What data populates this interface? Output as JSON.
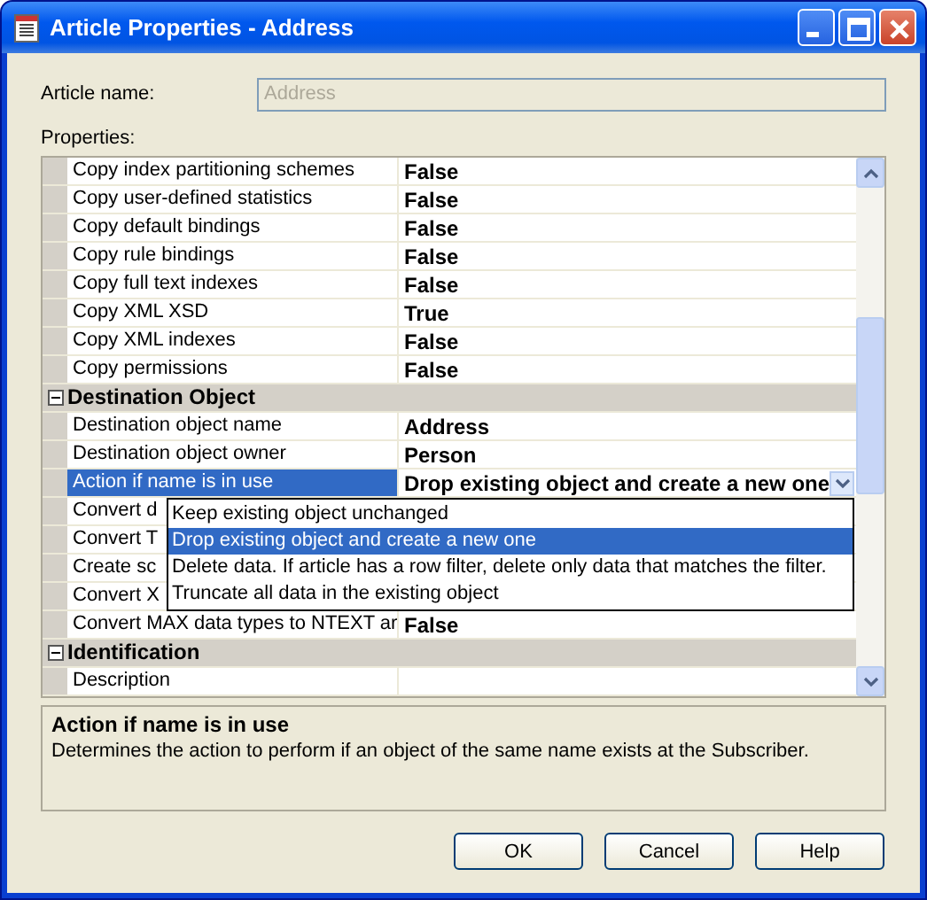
{
  "window": {
    "title": "Article Properties - Address"
  },
  "article_name": {
    "label": "Article name:",
    "value": "Address",
    "disabled": true
  },
  "properties_label": "Properties:",
  "grid": {
    "rows": [
      {
        "kind": "property",
        "name": "Copy index partitioning schemes",
        "value": "False",
        "selected": false
      },
      {
        "kind": "property",
        "name": "Copy user-defined statistics",
        "value": "False",
        "selected": false
      },
      {
        "kind": "property",
        "name": "Copy default bindings",
        "value": "False",
        "selected": false
      },
      {
        "kind": "property",
        "name": "Copy rule bindings",
        "value": "False",
        "selected": false
      },
      {
        "kind": "property",
        "name": "Copy full text indexes",
        "value": "False",
        "selected": false
      },
      {
        "kind": "property",
        "name": "Copy XML XSD",
        "value": "True",
        "selected": false
      },
      {
        "kind": "property",
        "name": "Copy XML indexes",
        "value": "False",
        "selected": false
      },
      {
        "kind": "property",
        "name": "Copy permissions",
        "value": "False",
        "selected": false
      },
      {
        "kind": "category",
        "name": "Destination Object",
        "expanded": true
      },
      {
        "kind": "property",
        "name": "Destination object name",
        "value": "Address",
        "selected": false
      },
      {
        "kind": "property",
        "name": "Destination object owner",
        "value": "Person",
        "selected": false
      },
      {
        "kind": "property",
        "name": "Action if name is in use",
        "value": "Drop existing object and create a new one",
        "selected": true,
        "dropdown_open": true
      },
      {
        "kind": "property",
        "name": "Convert d",
        "selected": false
      },
      {
        "kind": "property",
        "name": "Convert T",
        "selected": false
      },
      {
        "kind": "property",
        "name": "Create sc",
        "selected": false
      },
      {
        "kind": "property",
        "name": "Convert X",
        "selected": false
      },
      {
        "kind": "property",
        "name": "Convert MAX data types to NTEXT ar",
        "value": "False",
        "selected": false
      },
      {
        "kind": "category",
        "name": "Identification",
        "expanded": true
      },
      {
        "kind": "property",
        "name": "Description",
        "selected": false
      }
    ],
    "dropdown": {
      "options": [
        {
          "label": "Keep existing object unchanged",
          "selected": false
        },
        {
          "label": "Drop existing object and create a new one",
          "selected": true
        },
        {
          "label": "Delete data. If article has a row filter, delete only data that matches the filter.",
          "selected": false
        },
        {
          "label": "Truncate all data in the existing object",
          "selected": false
        }
      ]
    }
  },
  "description": {
    "title": "Action if name is in use",
    "text": "Determines the action to perform if an object of the same name exists at the Subscriber."
  },
  "buttons": [
    "OK",
    "Cancel",
    "Help"
  ]
}
